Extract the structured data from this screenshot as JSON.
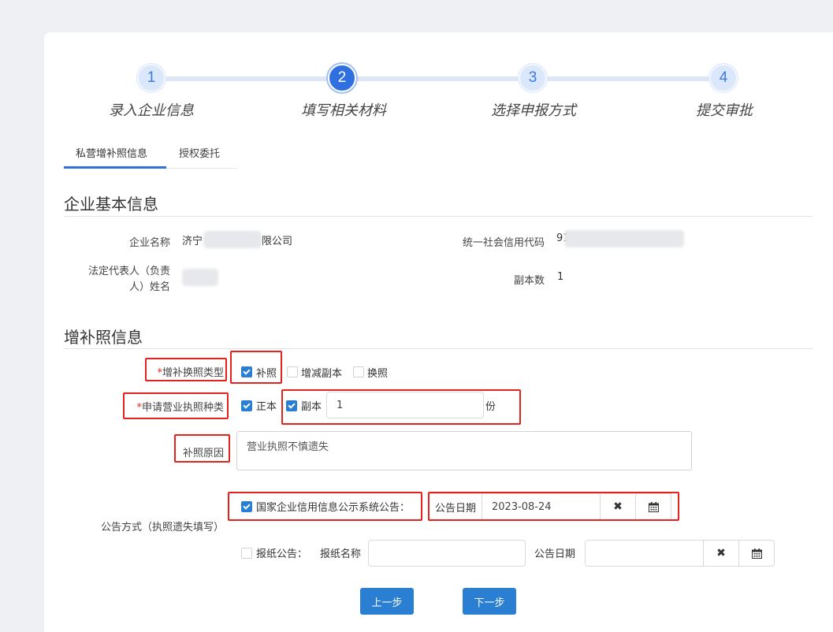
{
  "steps": [
    {
      "num": "1",
      "label": "录入企业信息"
    },
    {
      "num": "2",
      "label": "填写相关材料"
    },
    {
      "num": "3",
      "label": "选择申报方式"
    },
    {
      "num": "4",
      "label": "提交审批"
    }
  ],
  "tabs": [
    "私营增补照信息",
    "授权委托"
  ],
  "basic": {
    "title": "企业基本信息",
    "company_name_label": "企业名称",
    "company_name_prefix": "济宁",
    "company_name_suffix": "限公司",
    "credit_code_label": "统一社会信用代码",
    "credit_code_prefix": "91",
    "legal_rep_label_1": "法定代表人（负责",
    "legal_rep_label_2": "人）姓名",
    "copies_label": "副本数",
    "copies_value": "1"
  },
  "supp": {
    "title": "增补照信息",
    "type_label": "*增补换照类型",
    "type_options": [
      "补照",
      "增减副本",
      "换照"
    ],
    "kind_label": "*申请营业执照种类",
    "kind_original": "正本",
    "kind_copy": "副本",
    "kind_copy_count": "1",
    "kind_unit": "份",
    "reason_label": "补照原因",
    "reason_value": "营业执照不慎遗失",
    "notice_label": "公告方式（执照遗失填写）",
    "notice_system": "国家企业信用信息公示系统公告：",
    "notice_date_label": "公告日期",
    "notice_date_value": "2023-08-24",
    "paper_label": "报纸公告：",
    "paper_name_label": "报纸名称",
    "paper_date_label": "公告日期"
  },
  "buttons": {
    "prev": "上一步",
    "next": "下一步"
  },
  "icons": {
    "clear": "✖",
    "calendar": "calendar-icon"
  },
  "colors": {
    "accent": "#2a7fd2",
    "highlight": "#e8211c"
  }
}
